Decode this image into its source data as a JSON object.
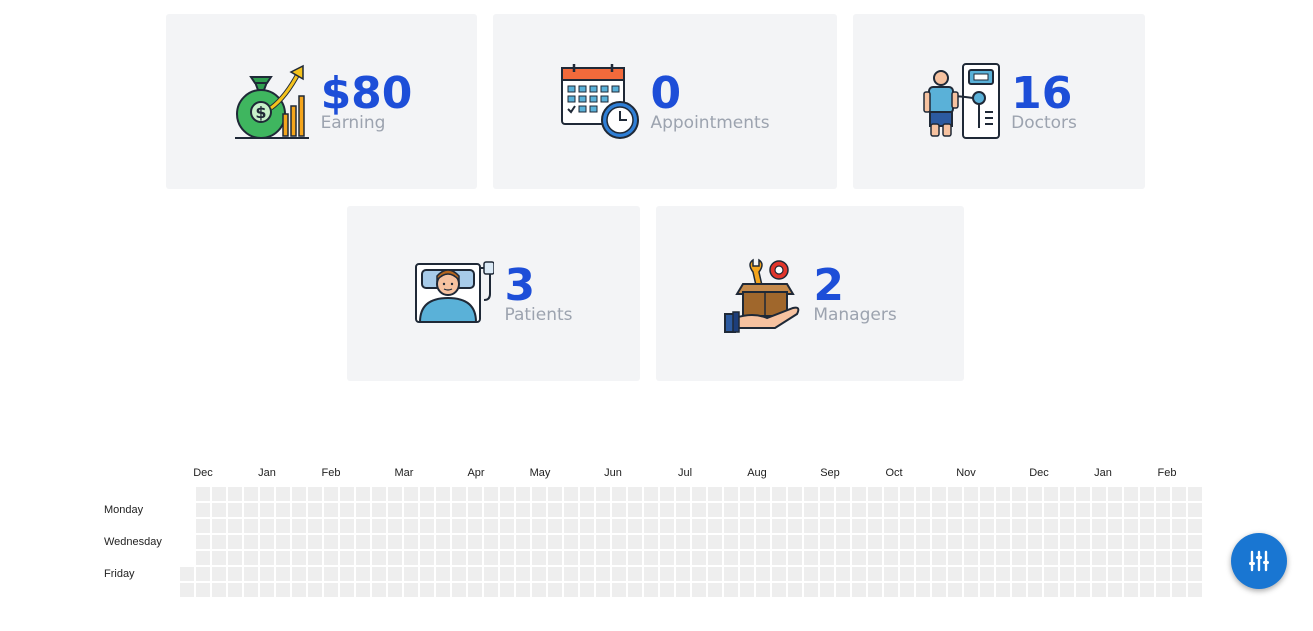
{
  "stats": {
    "earning": {
      "value": "$80",
      "label": "Earning"
    },
    "appointments": {
      "value": "0",
      "label": "Appointments"
    },
    "doctors": {
      "value": "16",
      "label": "Doctors"
    },
    "patients": {
      "value": "3",
      "label": "Patients"
    },
    "managers": {
      "value": "2",
      "label": "Managers"
    }
  },
  "heatmap": {
    "months": [
      "Dec",
      "Jan",
      "Feb",
      "Mar",
      "Apr",
      "May",
      "Jun",
      "Jul",
      "Aug",
      "Sep",
      "Oct",
      "Nov",
      "Dec",
      "Jan",
      "Feb"
    ],
    "weekdays": [
      "Monday",
      "Wednesday",
      "Friday"
    ],
    "empty_color": "#eeeeee"
  },
  "colors": {
    "accent": "#1d4ed8",
    "label": "#9ca3af",
    "card": "#f3f4f6",
    "fab": "#1976d2"
  },
  "icons": {
    "earning": "money-bag-growth-icon",
    "appointments": "calendar-clock-icon",
    "doctors": "doctor-machine-icon",
    "patients": "patient-bed-icon",
    "managers": "tools-box-hand-icon",
    "fab": "sliders-icon"
  }
}
